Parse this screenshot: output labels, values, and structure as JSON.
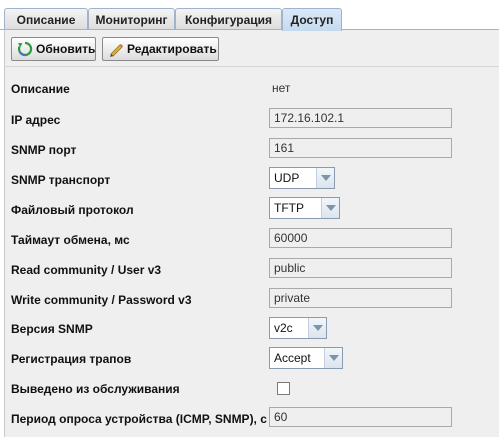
{
  "tabs": [
    {
      "label": "Описание",
      "active": false
    },
    {
      "label": "Мониторинг",
      "active": false
    },
    {
      "label": "Конфигурация",
      "active": false
    },
    {
      "label": "Доступ",
      "active": true
    }
  ],
  "toolbar": {
    "refresh_label": "Обновить",
    "edit_label": "Редактировать",
    "refresh_icon": "refresh-icon",
    "edit_icon": "pencil-icon"
  },
  "form": {
    "description": {
      "label": "Описание",
      "value": "нет"
    },
    "ip": {
      "label": "IP адрес",
      "value": "172.16.102.1"
    },
    "snmp_port": {
      "label": "SNMP порт",
      "value": "161"
    },
    "snmp_transport": {
      "label": "SNMP транспорт",
      "value": "UDP"
    },
    "file_protocol": {
      "label": "Файловый протокол",
      "value": "TFTP"
    },
    "timeout": {
      "label": "Таймаут обмена, мс",
      "value": "60000"
    },
    "read_community": {
      "label": "Read community / User v3",
      "value": "public"
    },
    "write_community": {
      "label": "Write community / Password v3",
      "value": "private"
    },
    "snmp_version": {
      "label": "Версия SNMP",
      "value": "v2c"
    },
    "trap_registration": {
      "label": "Регистрация трапов",
      "value": "Accept"
    },
    "out_of_service": {
      "label": "Выведено из обслуживания",
      "checked": false
    },
    "poll_period": {
      "label": "Период опроса устройства (ICMP, SNMP), с",
      "value": "60"
    }
  },
  "colors": {
    "active_tab": "#c6daef",
    "panel_bg": "#efefef",
    "border": "#9fb4cc"
  }
}
